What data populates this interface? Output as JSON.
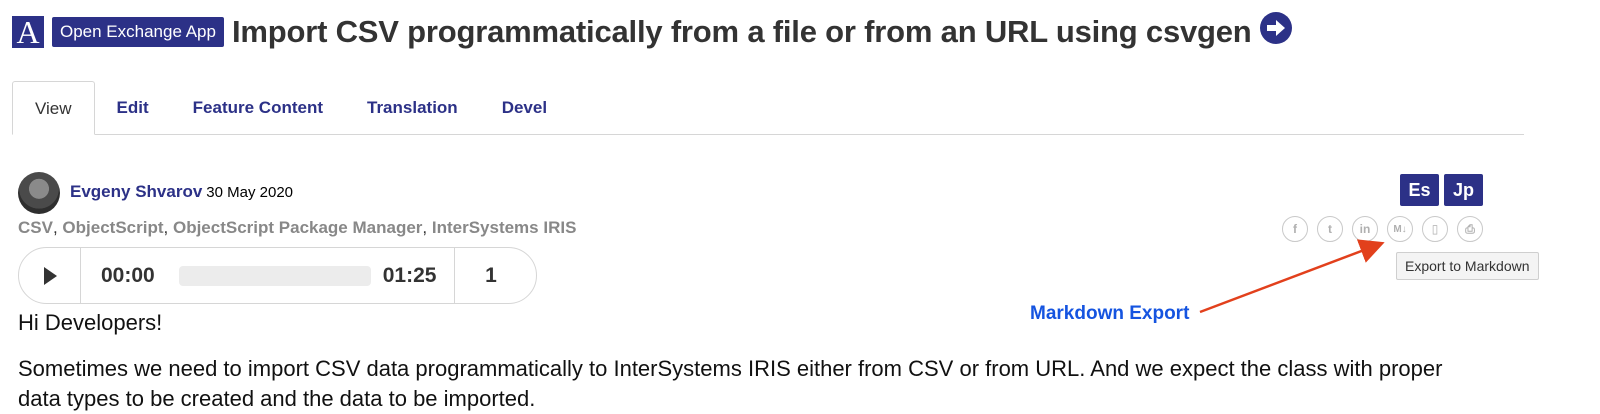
{
  "header": {
    "logo_letter": "A",
    "badge": "Open Exchange App",
    "title": "Import CSV programmatically from a file or from an URL using csvgen"
  },
  "tabs": [
    {
      "label": "View",
      "active": true
    },
    {
      "label": "Edit"
    },
    {
      "label": "Feature Content"
    },
    {
      "label": "Translation"
    },
    {
      "label": "Devel"
    }
  ],
  "author": {
    "name": "Evgeny Shvarov",
    "date": "30 May 2020"
  },
  "tags": [
    "CSV",
    "ObjectScript",
    "ObjectScript Package Manager",
    "InterSystems IRIS"
  ],
  "languages": [
    "Es",
    "Jp"
  ],
  "share_icons": [
    "facebook-icon",
    "twitter-icon",
    "linkedin-icon",
    "markdown-icon",
    "document-icon",
    "print-icon"
  ],
  "share_glyphs": [
    "f",
    "t",
    "in",
    "M↓",
    "▯",
    "⎙"
  ],
  "tooltip": "Export to Markdown",
  "annotation": {
    "label": "Markdown Export",
    "color": "#1554e0",
    "arrow_color": "#e2401c"
  },
  "player": {
    "current": "00:00",
    "total": "01:25",
    "speed": "1",
    "progress": 0
  },
  "content": {
    "greeting": "Hi Developers!",
    "paragraph": "Sometimes we need to import CSV data programmatically to InterSystems IRIS either from CSV or from URL. And we expect the class with proper data types to be created and the data to be imported."
  },
  "colors": {
    "brand": "#2c3187"
  }
}
